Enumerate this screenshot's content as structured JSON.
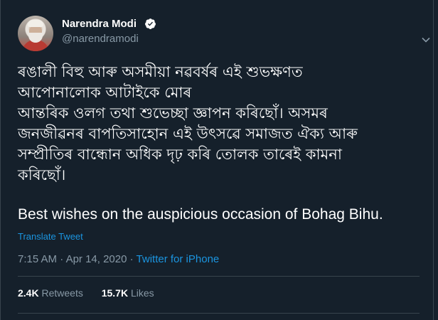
{
  "author": {
    "name": "Narendra Modi",
    "handle": "@narendramodi"
  },
  "tweet": {
    "text_lines": [
      "ৰঙালী বিহু আৰু অসমীয়া নৱবৰ্ষৰ এই শুভক্ষণত",
      "আপোনালোক আটাইকে মোৰ",
      "আন্তৰিক ওলগ তথা শুভেচ্ছা জ্ঞাপন কৰিছোঁ। অসমৰ",
      "জনজীৱনৰ বাপতিসাহোন এই উৎসৱে সমাজত ঐক্য আৰু",
      "সম্প্ৰীতিৰ বান্ধোন অধিক দৃঢ় কৰি তোলক তাৰেই কামনা",
      "কৰিছোঁ।"
    ],
    "english_text": "Best wishes on the auspicious occasion of Bohag Bihu.",
    "translate_label": "Translate Tweet",
    "time": "7:15 AM",
    "separator": " · ",
    "date": "Apr 14, 2020",
    "source": "Twitter for iPhone"
  },
  "stats": {
    "retweets_count": "2.4K",
    "retweets_label": "Retweets",
    "likes_count": "15.7K",
    "likes_label": "Likes"
  },
  "colors": {
    "background": "#15202b",
    "link": "#1b95e0",
    "secondary_text": "#8899a6",
    "verified_badge": "#ffffff"
  }
}
